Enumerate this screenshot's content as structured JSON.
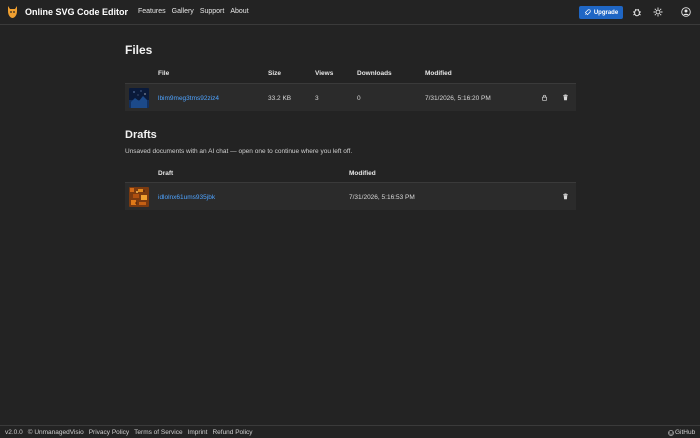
{
  "header": {
    "app_title": "Online SVG Code Editor",
    "nav": [
      "Features",
      "Gallery",
      "Support",
      "About"
    ],
    "upgrade_label": "Upgrade",
    "accent": "#1f66c4"
  },
  "files": {
    "title": "Files",
    "columns": [
      "File",
      "Size",
      "Views",
      "Downloads",
      "Modified"
    ],
    "rows": [
      {
        "name": "lbim9meg3tms92ziz4",
        "size": "33.2 KB",
        "views": "3",
        "downloads": "0",
        "modified": "7/31/2026, 5:16:20 PM"
      }
    ]
  },
  "drafts": {
    "title": "Drafts",
    "description": "Unsaved documents with an AI chat — open one to continue where you left off.",
    "columns": [
      "Draft",
      "Modified"
    ],
    "rows": [
      {
        "name": "idlolnx61ums935jbk",
        "modified": "7/31/2026, 5:16:53 PM"
      }
    ]
  },
  "footer": {
    "version": "v2.0.0",
    "copyright": "© UnmanagedVisio",
    "links": [
      "Privacy Policy",
      "Terms of Service",
      "Imprint",
      "Refund Policy"
    ],
    "github": "GitHub"
  }
}
